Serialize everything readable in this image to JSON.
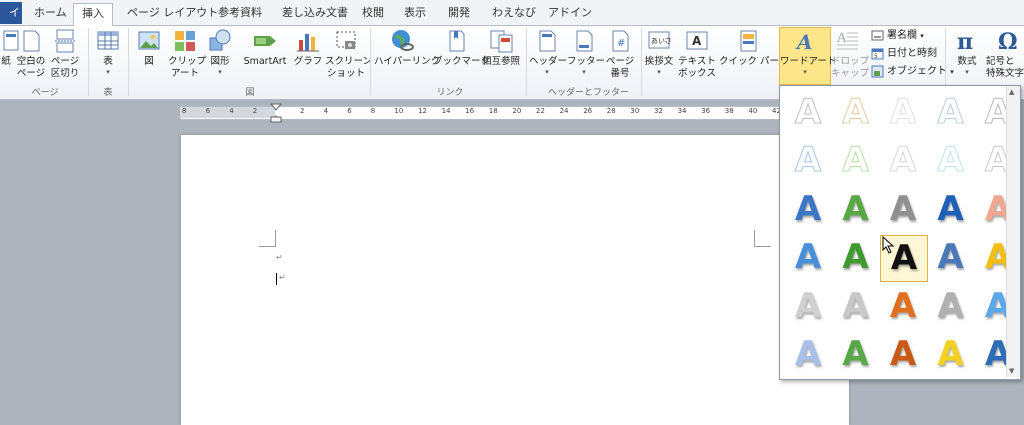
{
  "tabs": {
    "file": "イル",
    "home": "ホーム",
    "insert": "挿入",
    "page_layout": "ページ レイアウト",
    "references": "参考資料",
    "mailings": "差し込み文書",
    "review": "校閲",
    "view": "表示",
    "developer": "開発",
    "wawanabi": "わえなび",
    "addins": "アドイン"
  },
  "ribbon": {
    "page_group": {
      "label": "ページ",
      "items": [
        "紙",
        "空白の\nページ",
        "ページ\n区切り"
      ]
    },
    "table_group": {
      "label": "表",
      "table": "表"
    },
    "figure_group": {
      "label": "図",
      "items": [
        "図",
        "クリップ\nアート",
        "図形",
        "SmartArt",
        "グラフ",
        "スクリーン\nショット"
      ]
    },
    "link_group": {
      "label": "リンク",
      "items": [
        "ハイパーリンク",
        "ブックマーク",
        "相互参照"
      ]
    },
    "header_group": {
      "label": "ヘッダーとフッター",
      "items": [
        "ヘッダー",
        "フッター",
        "ページ\n番号"
      ]
    },
    "text_group": {
      "items": [
        "挨拶文",
        "テキスト\nボックス",
        "クイック パーツ",
        "ワードアート",
        "ドロップ\nキャップ"
      ],
      "signature": "署名欄",
      "datetime": "日付と時刻",
      "object": "オブジェクト"
    },
    "symbol_group": {
      "equation": "数式",
      "symbol": "記号と\n特殊文字"
    }
  },
  "ruler": {
    "ticks": [
      "8",
      "6",
      "4",
      "2",
      "",
      "2",
      "4",
      "6",
      "8",
      "10",
      "12",
      "14",
      "16",
      "18",
      "20",
      "22",
      "24",
      "26",
      "28",
      "30",
      "32",
      "34",
      "36",
      "38",
      "40",
      "42"
    ]
  },
  "gallery": {
    "glyph": "A",
    "styles": [
      [
        "#c0c0c0",
        "#e8c8a0",
        "#e0e0e0",
        "#b8cce8",
        "#b8b8b8"
      ],
      [
        "#aac4e8",
        "#b8e0a8",
        "#d8d8d8",
        "#bfe4f4",
        "#c8c8c8"
      ],
      [
        "#3b75c4",
        "#57a844",
        "#909090",
        "#1f5fb8",
        "#f0a890"
      ],
      [
        "#4a90d8",
        "#3e9a2e",
        "#111111",
        "#4a78b8",
        "#f2c012"
      ],
      [
        "#d0d0d0",
        "#c8c8c8",
        "#e07020",
        "#b0b0b0",
        "#5aa8e8"
      ],
      [
        "#a8c0e8",
        "#58a848",
        "#c85a18",
        "#f4d020",
        "#2e6cb8"
      ]
    ]
  }
}
